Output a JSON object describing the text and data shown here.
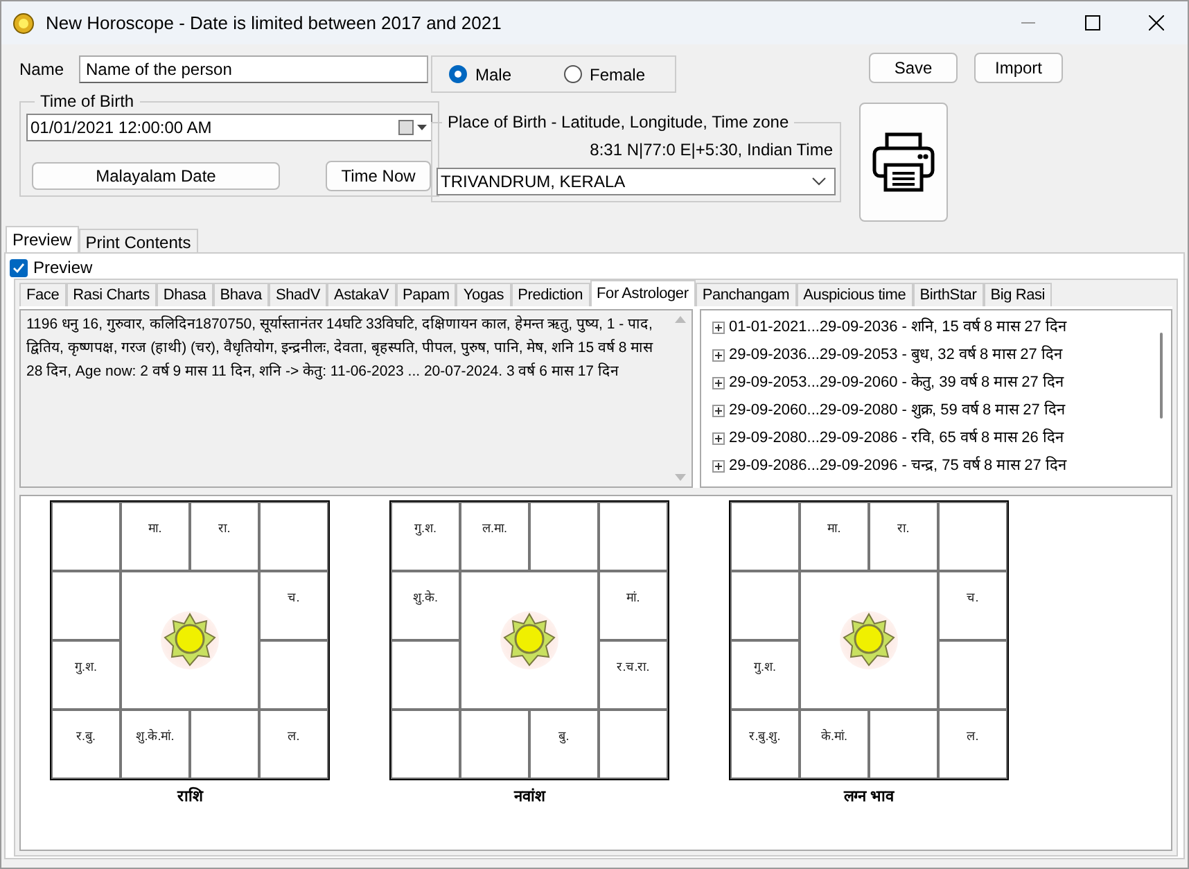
{
  "window": {
    "title": "New Horoscope - Date is limited between 2017 and 2021"
  },
  "name_field": {
    "label": "Name",
    "value": "Name of the person"
  },
  "gender": [
    {
      "label": "Male",
      "selected": true
    },
    {
      "label": "Female",
      "selected": false
    }
  ],
  "buttons": {
    "save": "Save",
    "import": "Import"
  },
  "time_of_birth": {
    "legend": "Time of Birth",
    "value": "01/01/2021  12:00:00 AM",
    "malayalam_date": "Malayalam Date",
    "time_now": "Time Now"
  },
  "place_of_birth": {
    "legend": "Place of Birth - Latitude, Longitude, Time zone",
    "coordinates": "8:31 N|77:0 E|+5:30, Indian Time",
    "value": "TRIVANDRUM, KERALA"
  },
  "outer_tabs": [
    {
      "label": "Preview",
      "selected": true
    },
    {
      "label": "Print Contents",
      "selected": false
    }
  ],
  "preview": {
    "label": "Preview",
    "checked": true
  },
  "inner_tabs": [
    {
      "label": "Face",
      "selected": false
    },
    {
      "label": "Rasi Charts",
      "selected": false
    },
    {
      "label": "Dhasa",
      "selected": false
    },
    {
      "label": "Bhava",
      "selected": false
    },
    {
      "label": "ShadV",
      "selected": false
    },
    {
      "label": "AstakaV",
      "selected": false
    },
    {
      "label": "Papam",
      "selected": false
    },
    {
      "label": "Yogas",
      "selected": false
    },
    {
      "label": "Prediction",
      "selected": false
    },
    {
      "label": "For Astrologer",
      "selected": true
    },
    {
      "label": "Panchangam",
      "selected": false
    },
    {
      "label": "Auspicious time",
      "selected": false
    },
    {
      "label": "BirthStar",
      "selected": false
    },
    {
      "label": "Big Rasi",
      "selected": false
    }
  ],
  "details_text": "1196 धनु   16, गुरुवार, कलिदिन1870750, सूर्यास्तानंतर 14घटि 33विघटि, दक्षिणायन काल, हेमन्त ऋतु, पुष्य, 1 - पाद, द्वितिय, कृष्णपक्ष, गरज (हाथी) (चर), वैधृतियोग, इन्द्रनीलः, देवता, बृहस्पति, पीपल, पुरुष, पानि, मेष, शनि 15 वर्ष 8 मास 28 दिन, Age now: 2 वर्ष 9 मास 11 दिन, शनि -> केतु: 11-06-2023 ... 20-07-2024.  3 वर्ष 6 मास 17 दिन",
  "dasha_tree": [
    {
      "label": "01-01-2021...29-09-2036 - शनि, 15 वर्ष 8 मास 27 दिन",
      "expanded": false
    },
    {
      "label": "29-09-2036...29-09-2053 - बुध, 32 वर्ष 8 मास 27 दिन",
      "expanded": false
    },
    {
      "label": "29-09-2053...29-09-2060 - केतु, 39 वर्ष 8 मास 27 दिन",
      "expanded": false
    },
    {
      "label": "29-09-2060...29-09-2080 - शुक्र, 59 वर्ष 8 मास 27 दिन",
      "expanded": false
    },
    {
      "label": "29-09-2080...29-09-2086 - रवि, 65 वर्ष 8 मास 26 दिन",
      "expanded": false
    },
    {
      "label": "29-09-2086...29-09-2096 - चन्द्र, 75 वर्ष 8 मास 27 दिन",
      "expanded": false
    }
  ],
  "charts": [
    {
      "caption": "राशि",
      "cells": [
        {},
        {
          "text": "मा."
        },
        {
          "text": "रा."
        },
        {},
        {},
        {
          "text": "च."
        },
        {
          "text": "गु.श."
        },
        {},
        {
          "text": "र.बु."
        },
        {
          "text": "शु.के.मां."
        },
        {},
        {
          "text": "ल."
        }
      ]
    },
    {
      "caption": "नवांश",
      "cells": [
        {
          "text": "गु.श."
        },
        {
          "text": "ल.मा."
        },
        {},
        {},
        {
          "text": "शु.के."
        },
        {
          "text": "मां."
        },
        {},
        {
          "text": "र.च.रा."
        },
        {},
        {},
        {
          "text": "बु."
        },
        {}
      ]
    },
    {
      "caption": "लग्न भाव",
      "cells": [
        {},
        {
          "text": "मा."
        },
        {
          "text": "रा."
        },
        {},
        {},
        {
          "text": "च."
        },
        {
          "text": "गु.श."
        },
        {},
        {
          "text": "र.बु.शु."
        },
        {
          "text": "के.मां."
        },
        {},
        {
          "text": "ल."
        }
      ]
    }
  ]
}
